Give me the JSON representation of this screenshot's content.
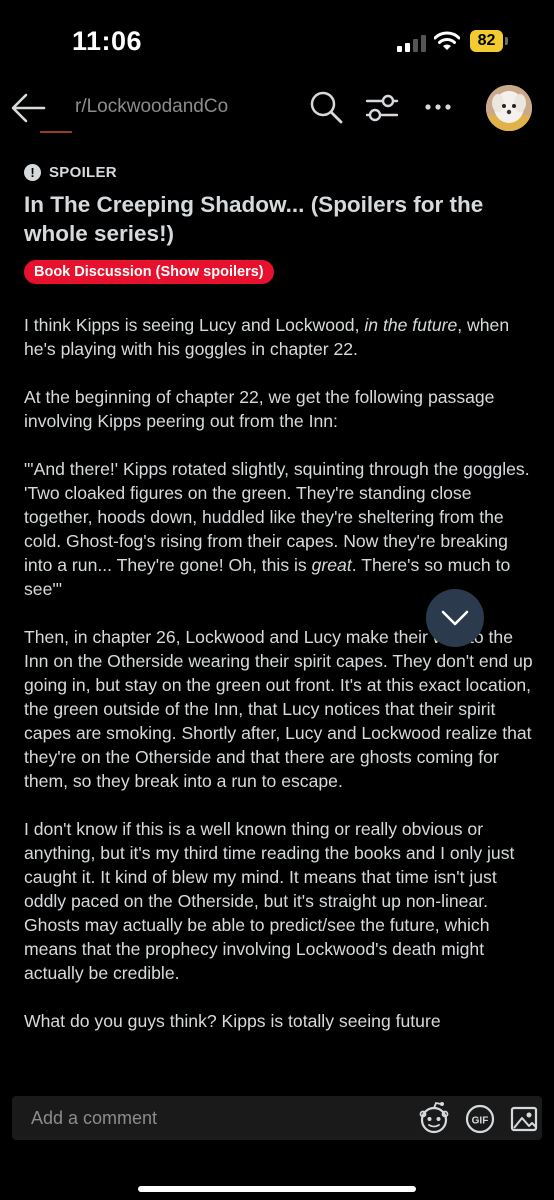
{
  "status_bar": {
    "time": "11:06",
    "battery": "82",
    "battery_color": "#f1cb2f"
  },
  "nav": {
    "subreddit": "r/LockwoodandCo",
    "icons": [
      "back-arrow-icon",
      "search-icon",
      "filter-icon",
      "more-icon",
      "avatar"
    ]
  },
  "post": {
    "spoiler_label": "SPOILER",
    "title": "In The Creeping Shadow... (Spoilers for the whole series!)",
    "flair": "Book Discussion (Show spoilers)",
    "flair_color": "#e8112d",
    "body": {
      "p1_a": "I think Kipps is seeing Lucy and Lockwood, ",
      "p1_em": "in the future",
      "p1_b": ", when he's playing with his goggles in chapter 22.",
      "p2": "At the beginning of chapter 22, we get the following passage involving Kipps peering out from the Inn:",
      "p3_a": "\"'And there!' Kipps rotated slightly, squinting through the goggles. 'Two cloaked figures on the green. They're standing close together, hoods down, huddled like they're sheltering from the cold. Ghost-fog's rising from their capes. Now they're breaking into a run... They're gone! Oh, this is ",
      "p3_em": "great",
      "p3_b": ". There's so much to see'\"",
      "p4": "Then, in chapter 26, Lockwood and Lucy make their way to the Inn on the Otherside wearing their spirit capes. They don't end up going in, but stay on the green out front. It's at this exact location, the green outside of the Inn, that Lucy notices that their spirit capes are smoking. Shortly after, Lucy and Lockwood realize that they're on the Otherside and that there are ghosts coming for them, so they break into a run to escape.",
      "p5": "I don't know if this is a well known thing or really obvious or anything, but it's my third time reading the books and I only just caught it. It kind of blew my mind. It means that time isn't just oddly paced on the Otherside, but it's straight up non-linear. Ghosts may actually be able to predict/see the future, which means that the prophecy involving Lockwood's death might actually be credible.",
      "p6": "What do you guys think? Kipps is totally seeing future"
    }
  },
  "fab_icon": "chevron-down-icon",
  "comment_bar": {
    "placeholder": "Add a comment",
    "icons": [
      "snoo-icon",
      "gif-icon",
      "image-icon"
    ]
  }
}
